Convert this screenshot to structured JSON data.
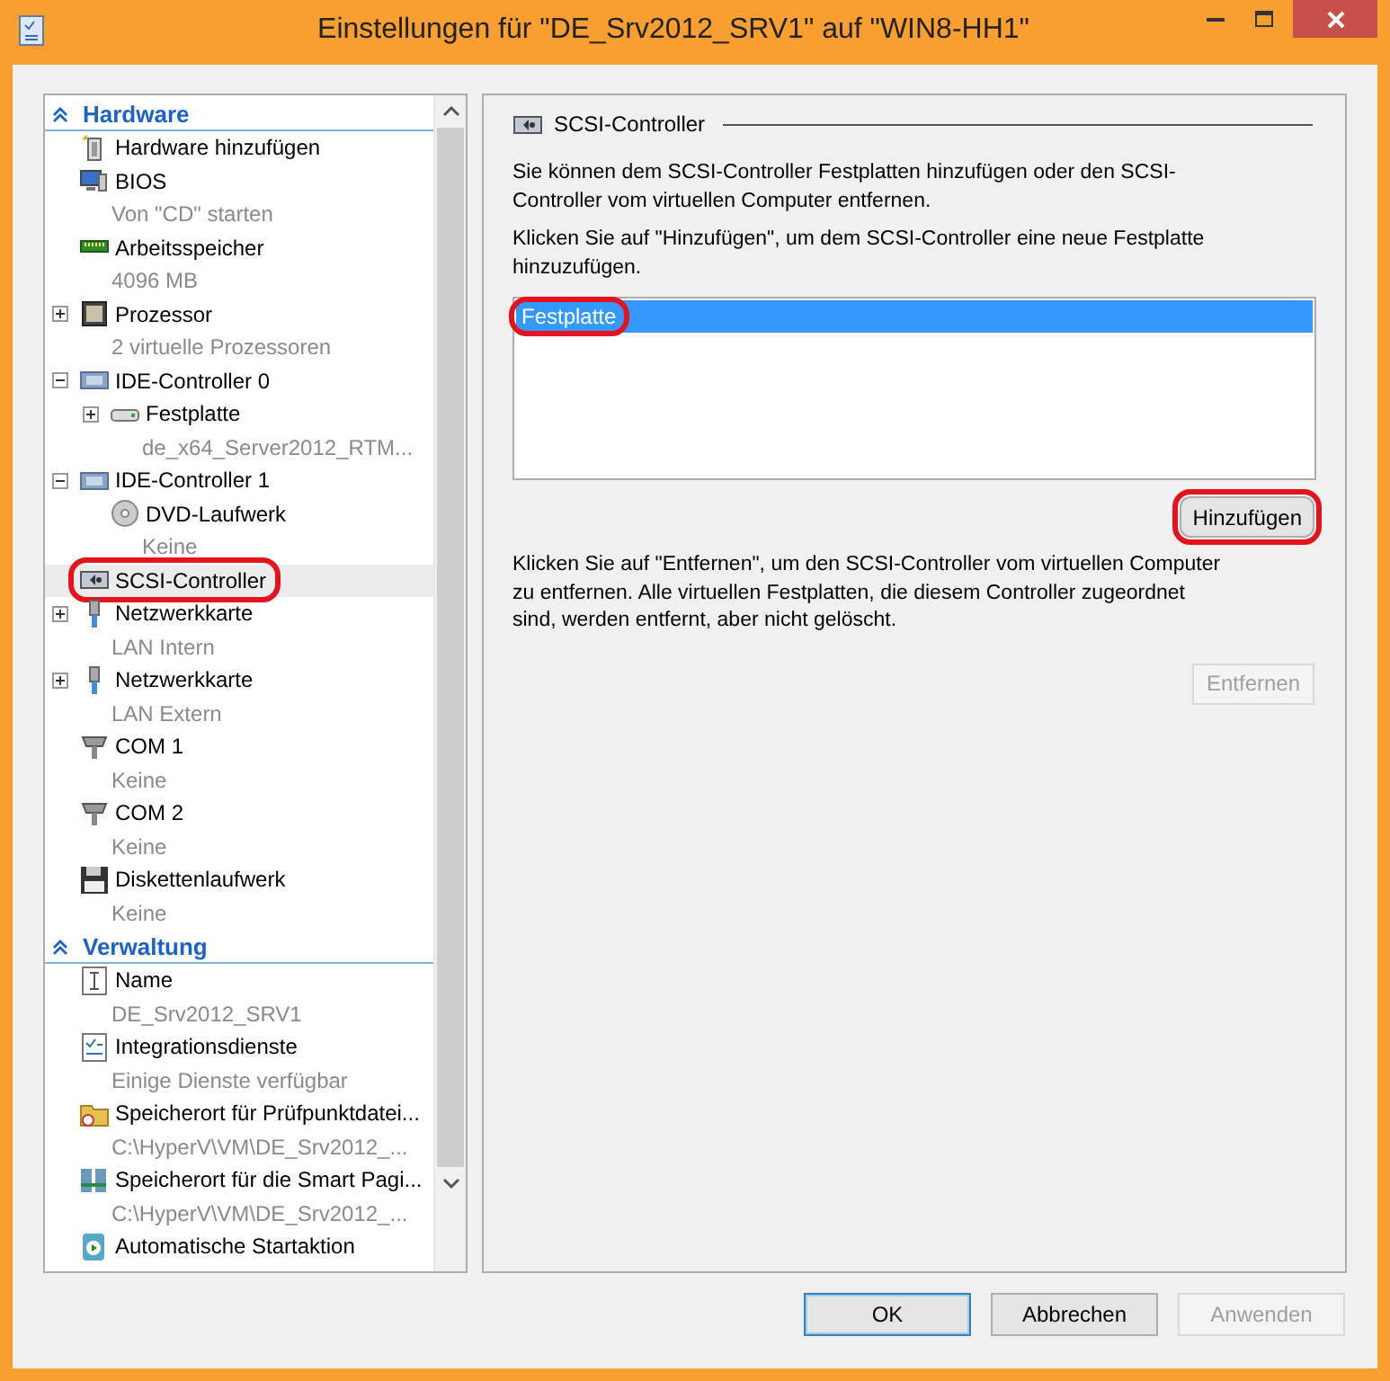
{
  "window": {
    "title": "Einstellungen für \"DE_Srv2012_SRV1\" auf \"WIN8-HH1\""
  },
  "sidebar": {
    "sections": [
      {
        "title": "Hardware",
        "expanded": true,
        "items": [
          {
            "kind": "add",
            "label": "Hardware hinzufügen",
            "selected": false
          },
          {
            "kind": "bios",
            "label": "BIOS",
            "detail": "Von \"CD\" starten",
            "selected": false
          },
          {
            "kind": "memory",
            "label": "Arbeitsspeicher",
            "detail": "4096 MB",
            "selected": false
          },
          {
            "kind": "cpu",
            "label": "Prozessor",
            "detail": "2 virtuelle Prozessoren",
            "expanded": false,
            "selected": false
          },
          {
            "kind": "controller",
            "label": "IDE-Controller 0",
            "expanded": true,
            "selected": false,
            "children": [
              {
                "kind": "disk",
                "label": "Festplatte",
                "detail": "de_x64_Server2012_RTM...",
                "expanded": false,
                "selected": false
              }
            ]
          },
          {
            "kind": "controller",
            "label": "IDE-Controller 1",
            "expanded": true,
            "selected": false,
            "children": [
              {
                "kind": "dvd",
                "label": "DVD-Laufwerk",
                "detail": "Keine",
                "selected": false
              }
            ]
          },
          {
            "kind": "scsi",
            "label": "SCSI-Controller",
            "selected": true,
            "annotated": true
          },
          {
            "kind": "network",
            "label": "Netzwerkkarte",
            "detail": "LAN Intern",
            "expanded": false,
            "selected": false
          },
          {
            "kind": "network",
            "label": "Netzwerkkarte",
            "detail": "LAN Extern",
            "expanded": false,
            "selected": false
          },
          {
            "kind": "com",
            "label": "COM 1",
            "detail": "Keine",
            "selected": false
          },
          {
            "kind": "com",
            "label": "COM 2",
            "detail": "Keine",
            "selected": false
          },
          {
            "kind": "floppy",
            "label": "Diskettenlaufwerk",
            "detail": "Keine",
            "selected": false
          }
        ]
      },
      {
        "title": "Verwaltung",
        "expanded": true,
        "items": [
          {
            "kind": "name",
            "label": "Name",
            "detail": "DE_Srv2012_SRV1",
            "selected": false
          },
          {
            "kind": "integration",
            "label": "Integrationsdienste",
            "detail": "Einige Dienste verfügbar",
            "selected": false
          },
          {
            "kind": "folder",
            "label": "Speicherort für Prüfpunktdatei...",
            "detail": "C:\\HyperV\\VM\\DE_Srv2012_...",
            "selected": false
          },
          {
            "kind": "paging",
            "label": "Speicherort für die Smart Pagi...",
            "detail": "C:\\HyperV\\VM\\DE_Srv2012_...",
            "selected": false
          },
          {
            "kind": "startup",
            "label": "Automatische Startaktion",
            "selected": false
          }
        ]
      }
    ]
  },
  "panel": {
    "title": "SCSI-Controller",
    "intro": "Sie können dem SCSI-Controller Festplatten hinzufügen oder den SCSI-Controller vom virtuellen Computer entfernen.",
    "add_hint": "Klicken Sie auf \"Hinzufügen\", um dem SCSI-Controller eine neue Festplatte hinzuzufügen.",
    "list": [
      {
        "label": "Festplatte",
        "selected": true,
        "annotated": true
      }
    ],
    "add_button": {
      "label": "Hinzufügen",
      "disabled": false,
      "annotated": true
    },
    "remove_hint": "Klicken Sie auf \"Entfernen\", um den SCSI-Controller vom virtuellen Computer zu entfernen. Alle virtuellen Festplatten, die diesem Controller zugeordnet sind, werden entfernt, aber nicht gelöscht.",
    "remove_button": {
      "label": "Entfernen",
      "disabled": true,
      "annotated": false
    }
  },
  "buttons": [
    {
      "label": "OK",
      "default": true,
      "disabled": false
    },
    {
      "label": "Abbrechen",
      "default": false,
      "disabled": false
    },
    {
      "label": "Anwenden",
      "default": false,
      "disabled": true
    }
  ]
}
